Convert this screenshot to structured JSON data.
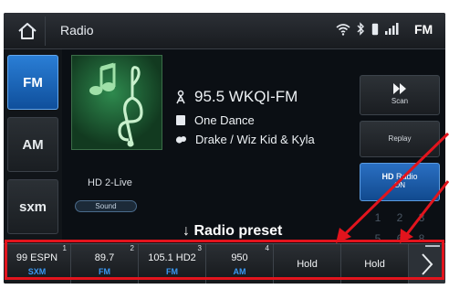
{
  "statusbar": {
    "title": "Radio",
    "band_indicator": "FM",
    "icons": [
      "home-icon",
      "wifi-icon",
      "bluetooth-icon",
      "phone-icon",
      "signal-icon"
    ]
  },
  "bands": [
    {
      "label": "FM",
      "active": true
    },
    {
      "label": "AM",
      "active": false
    },
    {
      "label": "sxm",
      "active": false
    }
  ],
  "now_playing": {
    "hd_label": "HD 2-Live",
    "sound_label": "Sound",
    "station": "95.5 WKQI-FM",
    "song": "One Dance",
    "artist": "Drake / Wiz Kid & Kyla"
  },
  "right_buttons": {
    "scan": {
      "label": "Scan",
      "icon": "fast-forward-icon"
    },
    "replay": {
      "label": "Replay"
    },
    "hd_radio": {
      "label": "Radio",
      "sub": "ON"
    },
    "number_grid": [
      "1",
      "2",
      "3",
      "5",
      "6",
      "8"
    ]
  },
  "annotation": {
    "caption": "↓ Radio preset",
    "highlight_color": "#e2141d"
  },
  "presets": [
    {
      "number": "1",
      "freq": "99 ESPN",
      "band": "SXM"
    },
    {
      "number": "2",
      "freq": "89.7",
      "band": "FM"
    },
    {
      "number": "3",
      "freq": "105.1 HD2",
      "band": "FM"
    },
    {
      "number": "4",
      "freq": "950",
      "band": "AM"
    },
    {
      "number": "",
      "freq": "Hold",
      "band": ""
    },
    {
      "number": "",
      "freq": "Hold",
      "band": ""
    }
  ],
  "next_icon": "chevron-right-icon"
}
